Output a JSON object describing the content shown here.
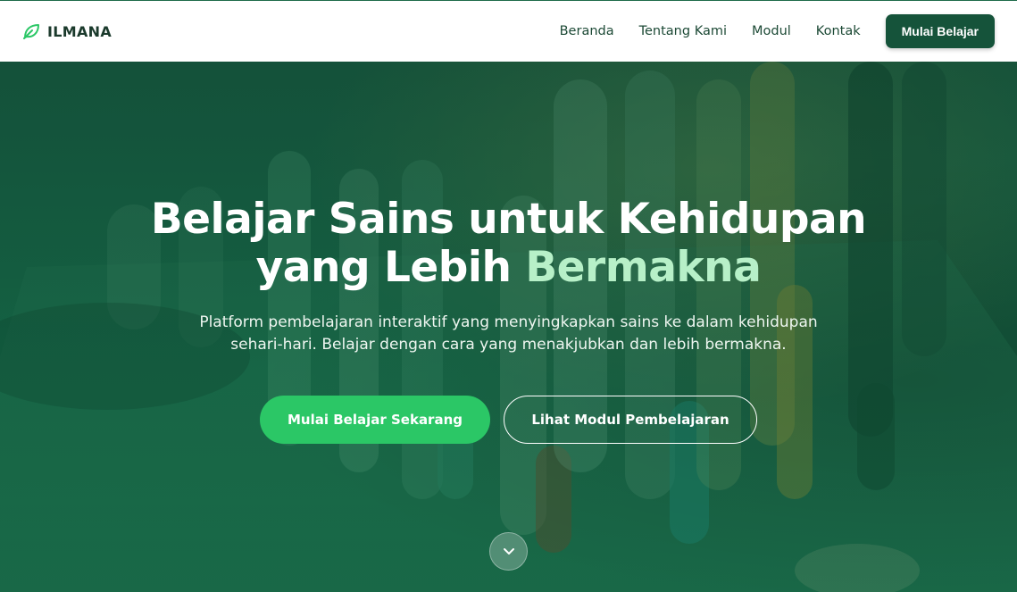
{
  "brand": {
    "name": "ILMANA",
    "icon": "leaf-icon"
  },
  "nav": {
    "links": [
      "Beranda",
      "Tentang Kami",
      "Modul",
      "Kontak"
    ],
    "cta_label": "Mulai Belajar"
  },
  "hero": {
    "title_line1": "Belajar Sains untuk Kehidupan",
    "title_line2_plain": "yang Lebih ",
    "title_line2_accent": "Bermakna",
    "subtitle_line1": "Platform pembelajaran interaktif yang menyingkapkan sains ke dalam kehidupan",
    "subtitle_line2": "sehari-hari. Belajar dengan cara yang menakjubkan dan lebih bermakna.",
    "primary_button": "Mulai Belajar Sekarang",
    "secondary_button": "Lihat Modul Pembelajaran",
    "scroll_icon": "chevron-down-icon"
  },
  "colors": {
    "brand_dark": "#15533a",
    "accent_green": "#2bc766",
    "title_accent": "#b7f0c8"
  }
}
